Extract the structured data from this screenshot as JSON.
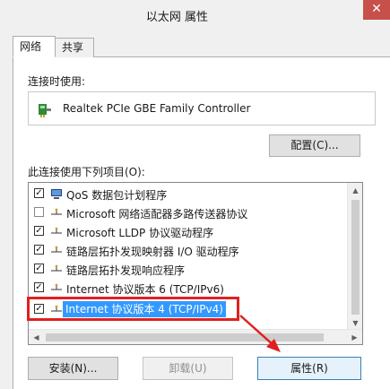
{
  "window": {
    "title": "以太网 属性",
    "close_glyph": "✕"
  },
  "tabs": [
    {
      "label": "网络"
    },
    {
      "label": "共享"
    }
  ],
  "connect_using": {
    "label": "连接时使用:",
    "adapter": "Realtek PCIe GBE Family Controller"
  },
  "configure_button": "配置(C)...",
  "items_label": "此连接使用下列项目(O):",
  "items": [
    {
      "label": "QoS 数据包计划程序",
      "checked": true,
      "icon": "qos-icon"
    },
    {
      "label": "Microsoft 网络适配器多路传送器协议",
      "checked": false,
      "icon": "protocol-icon"
    },
    {
      "label": "Microsoft LLDP 协议驱动程序",
      "checked": true,
      "icon": "protocol-icon"
    },
    {
      "label": "链路层拓扑发现映射器 I/O 驱动程序",
      "checked": true,
      "icon": "protocol-icon"
    },
    {
      "label": "链路层拓扑发现响应程序",
      "checked": true,
      "icon": "protocol-icon"
    },
    {
      "label": "Internet 协议版本 6 (TCP/IPv6)",
      "checked": true,
      "icon": "protocol-icon"
    },
    {
      "label": "Internet 协议版本 4 (TCP/IPv4)",
      "checked": true,
      "icon": "protocol-icon",
      "selected": true
    }
  ],
  "buttons": {
    "install": "安装(N)...",
    "uninstall": "卸载(U)",
    "properties": "属性(R)"
  },
  "colors": {
    "selection": "#3399ff",
    "annotation": "#e02020",
    "close": "#c7504a"
  }
}
